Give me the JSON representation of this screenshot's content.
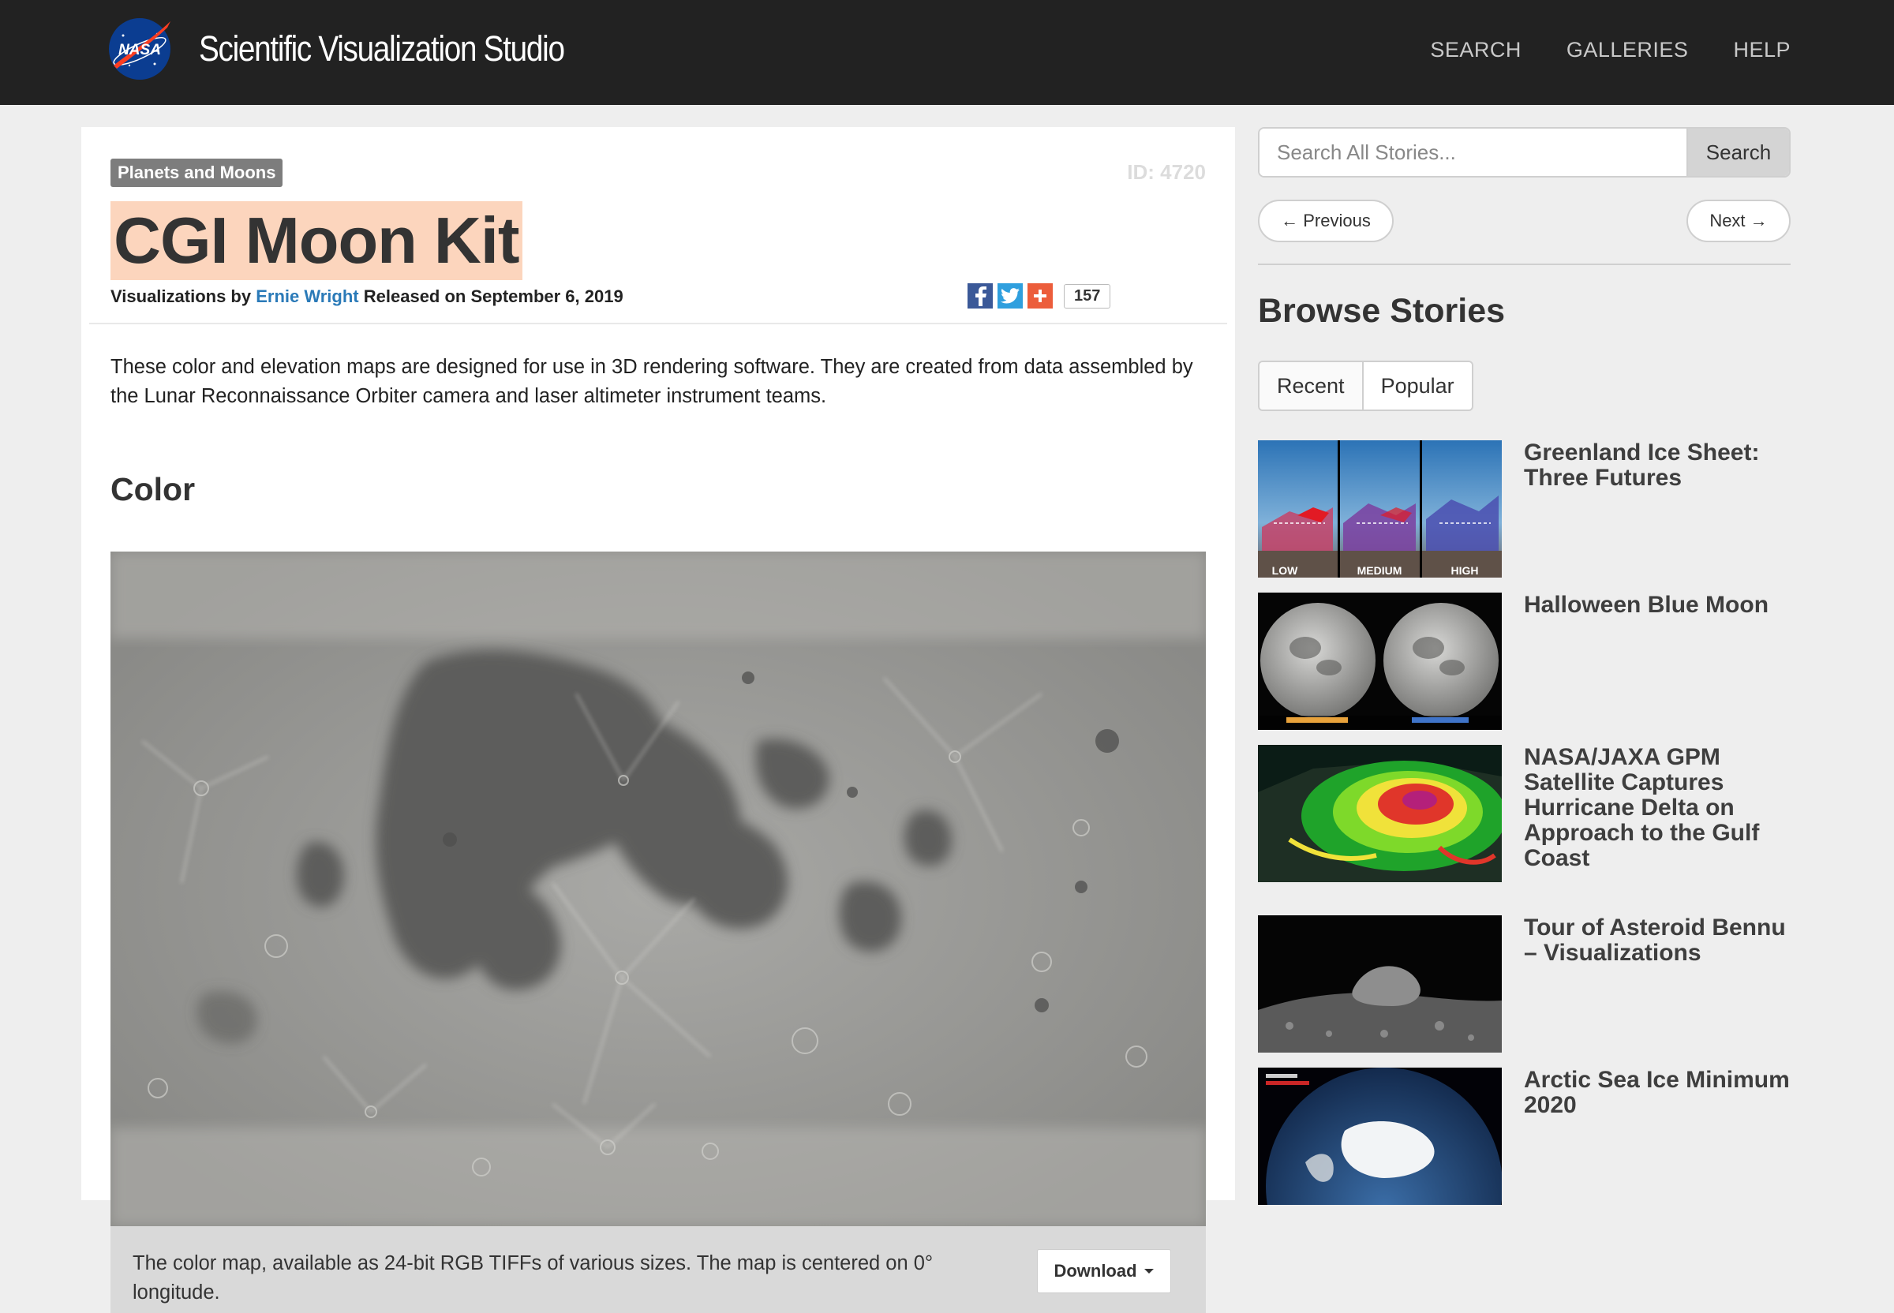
{
  "header": {
    "logo_icon": "nasa-meatball-logo",
    "site_title": "Scientific Visualization Studio",
    "nav": [
      {
        "label": "SEARCH"
      },
      {
        "label": "GALLERIES"
      },
      {
        "label": "HELP"
      }
    ]
  },
  "story": {
    "category": "Planets and Moons",
    "id_label": "ID: 4720",
    "title": "CGI Moon Kit",
    "byline_prefix": "Visualizations by",
    "author": "Ernie Wright",
    "released": "Released on September 6, 2019",
    "share_count": "157",
    "description": "These color and elevation maps are designed for use in 3D rendering software. They are created from data assembled by the Lunar Reconnaissance Orbiter camera and laser altimeter instrument teams.",
    "section_heading": "Color",
    "caption": "The color map, available as 24-bit RGB TIFFs of various sizes. The map is centered on 0° longitude.",
    "download_label": "Download"
  },
  "sidebar": {
    "search_placeholder": "Search All Stories...",
    "search_button": "Search",
    "previous_label": "← Previous",
    "next_label": "Next →",
    "browse_heading": "Browse Stories",
    "tabs": [
      {
        "label": "Recent"
      },
      {
        "label": "Popular"
      }
    ],
    "stories": [
      {
        "title": "Greenland Ice Sheet: Three Futures",
        "thumb_labels": [
          "LOW",
          "MEDIUM",
          "HIGH"
        ]
      },
      {
        "title": "Halloween Blue Moon"
      },
      {
        "title": "NASA/JAXA GPM Satellite Captures Hurricane Delta on Approach to the Gulf Coast"
      },
      {
        "title": "Tour of Asteroid Bennu – Visualizations"
      },
      {
        "title": "Arctic Sea Ice Minimum 2020"
      }
    ]
  },
  "colors": {
    "topbar": "#222222",
    "title_highlight": "#fcd5bd",
    "link": "#2a7ab8",
    "facebook": "#3b5998",
    "twitter": "#2f9fde",
    "share_plus": "#ec5d3b"
  }
}
